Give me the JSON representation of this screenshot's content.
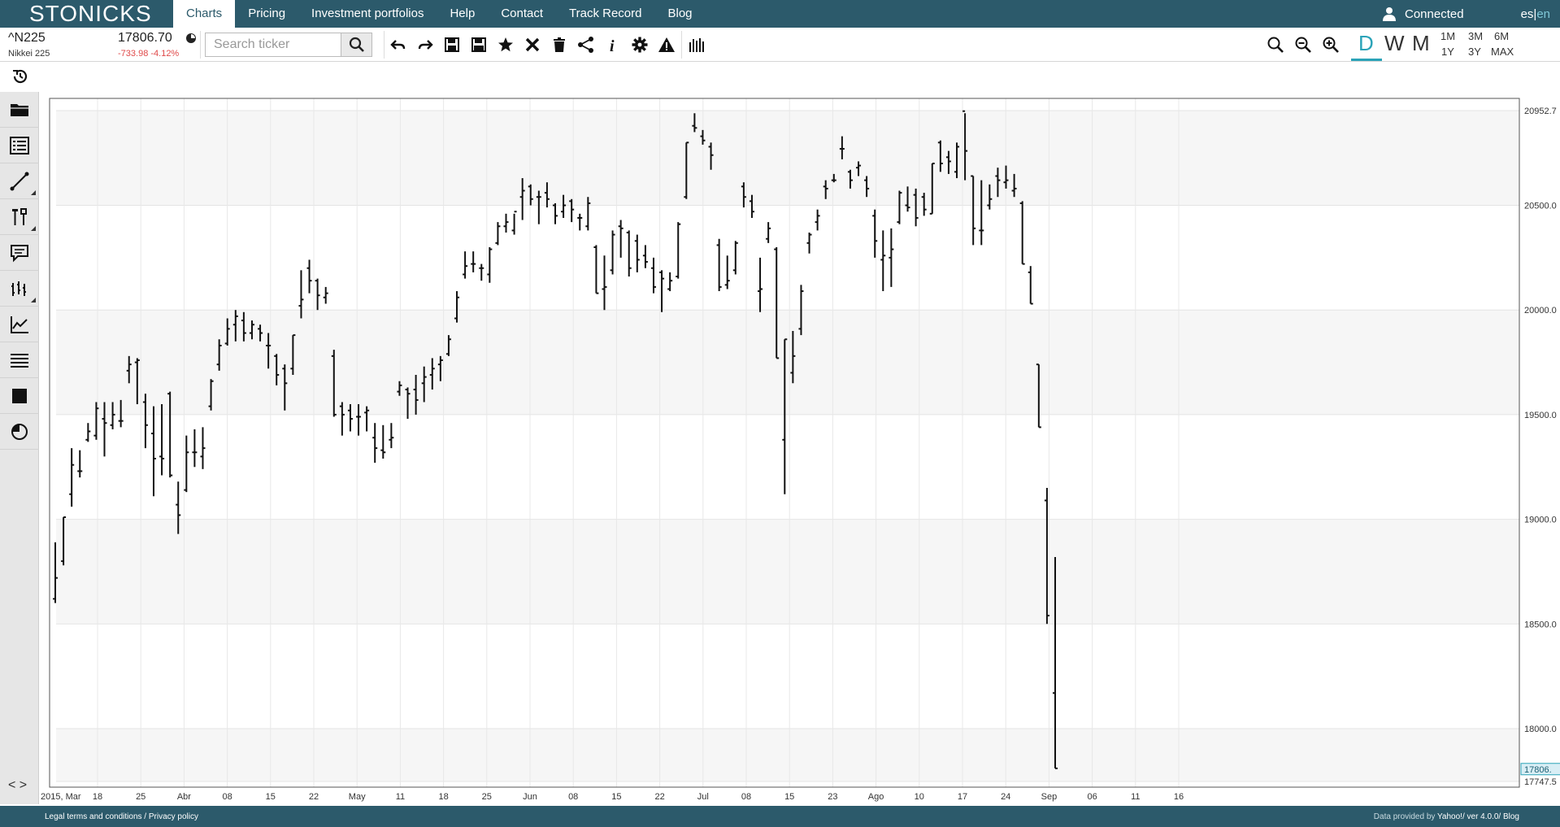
{
  "brand": {
    "logo_text": "STONICKS"
  },
  "nav": {
    "items": [
      {
        "label": "Charts",
        "active": true
      },
      {
        "label": "Pricing"
      },
      {
        "label": "Investment portfolios"
      },
      {
        "label": "Help"
      },
      {
        "label": "Contact"
      },
      {
        "label": "Track Record"
      },
      {
        "label": "Blog"
      }
    ],
    "user_status": "Connected",
    "lang_es": "es",
    "lang_sep": "|",
    "lang_en": "en"
  },
  "ticker": {
    "symbol": "^N225",
    "name": "Nikkei 225",
    "price": "17806.70",
    "change": "-733.98 -4.12%"
  },
  "search": {
    "placeholder": "Search ticker"
  },
  "toolbar_icons": [
    "undo-icon",
    "redo-icon",
    "save-icon",
    "save-all-icon",
    "star-icon",
    "close-icon",
    "trash-icon",
    "share-icon",
    "info-icon",
    "gear-icon",
    "warning-icon",
    "bar-chart-icon"
  ],
  "zoom_icons": [
    "search-icon",
    "zoom-out-icon",
    "zoom-in-icon"
  ],
  "periods": [
    {
      "label": "D",
      "active": true
    },
    {
      "label": "W"
    },
    {
      "label": "M"
    }
  ],
  "ranges": [
    "1M",
    "3M",
    "6M",
    "1Y",
    "3Y",
    "MAX"
  ],
  "sidebar": {
    "icons": [
      "folder-icon",
      "list-icon",
      "line-tool-icon",
      "tools-icon",
      "comment-icon",
      "indicators-icon",
      "line-chart-icon",
      "lines-icon",
      "square-icon",
      "pie-icon"
    ],
    "toggle_label": "< >"
  },
  "footer": {
    "legal": "Legal terms and conditions",
    "sep": " / ",
    "privacy": "Privacy policy",
    "provider_prefix": "Data provided by ",
    "provider": "Yahoo!",
    "version": "/ ver 4.0.0/ Blog"
  },
  "colors": {
    "nav_bg": "#2c5a6b",
    "accent": "#2ba3b8",
    "negative": "#e04a4a",
    "last_price_bg": "#d9eef5"
  },
  "chart_data": {
    "type": "ohlc",
    "ylim": [
      17747.5,
      20952.7
    ],
    "y_ticks": [
      "20952.7",
      "20500.0",
      "20000.0",
      "19500.0",
      "19000.0",
      "18500.0",
      "18000.0",
      "17747.5"
    ],
    "last_price_label": "17806.",
    "x_ticks": [
      "2015, Mar",
      "18",
      "25",
      "Abr",
      "08",
      "15",
      "22",
      "May",
      "11",
      "18",
      "25",
      "Jun",
      "08",
      "15",
      "22",
      "Jul",
      "08",
      "15",
      "23",
      "Ago",
      "10",
      "17",
      "24",
      "Sep",
      "06",
      "11",
      "16"
    ],
    "bars": [
      {
        "o": 18620,
        "h": 18890,
        "l": 18600,
        "c": 18720
      },
      {
        "o": 18800,
        "h": 19010,
        "l": 18780,
        "c": 19010
      },
      {
        "o": 19120,
        "h": 19340,
        "l": 19060,
        "c": 19260
      },
      {
        "o": 19230,
        "h": 19330,
        "l": 19200,
        "c": 19230
      },
      {
        "o": 19380,
        "h": 19460,
        "l": 19370,
        "c": 19420
      },
      {
        "o": 19400,
        "h": 19560,
        "l": 19380,
        "c": 19530
      },
      {
        "o": 19480,
        "h": 19560,
        "l": 19300,
        "c": 19460
      },
      {
        "o": 19450,
        "h": 19560,
        "l": 19430,
        "c": 19500
      },
      {
        "o": 19470,
        "h": 19570,
        "l": 19440,
        "c": 19470
      },
      {
        "o": 19710,
        "h": 19780,
        "l": 19650,
        "c": 19740
      },
      {
        "o": 19750,
        "h": 19770,
        "l": 19550,
        "c": 19760
      },
      {
        "o": 19560,
        "h": 19600,
        "l": 19340,
        "c": 19450
      },
      {
        "o": 19410,
        "h": 19540,
        "l": 19110,
        "c": 19290
      },
      {
        "o": 19300,
        "h": 19550,
        "l": 19210,
        "c": 19290
      },
      {
        "o": 19600,
        "h": 19610,
        "l": 19200,
        "c": 19210
      },
      {
        "o": 19070,
        "h": 19180,
        "l": 18930,
        "c": 19020
      },
      {
        "o": 19140,
        "h": 19400,
        "l": 19130,
        "c": 19320
      },
      {
        "o": 19320,
        "h": 19430,
        "l": 19250,
        "c": 19320
      },
      {
        "o": 19300,
        "h": 19440,
        "l": 19240,
        "c": 19340
      },
      {
        "o": 19540,
        "h": 19670,
        "l": 19520,
        "c": 19660
      },
      {
        "o": 19740,
        "h": 19860,
        "l": 19710,
        "c": 19830
      },
      {
        "o": 19840,
        "h": 19960,
        "l": 19830,
        "c": 19910
      },
      {
        "o": 19930,
        "h": 20000,
        "l": 19850,
        "c": 19970
      },
      {
        "o": 19950,
        "h": 19990,
        "l": 19850,
        "c": 19890
      },
      {
        "o": 19890,
        "h": 19950,
        "l": 19860,
        "c": 19930
      },
      {
        "o": 19910,
        "h": 19930,
        "l": 19850,
        "c": 19890
      },
      {
        "o": 19830,
        "h": 19890,
        "l": 19720,
        "c": 19830
      },
      {
        "o": 19780,
        "h": 19790,
        "l": 19640,
        "c": 19690
      },
      {
        "o": 19720,
        "h": 19740,
        "l": 19520,
        "c": 19650
      },
      {
        "o": 19720,
        "h": 19880,
        "l": 19690,
        "c": 19880
      },
      {
        "o": 20020,
        "h": 20190,
        "l": 19960,
        "c": 20050
      },
      {
        "o": 20200,
        "h": 20240,
        "l": 20080,
        "c": 20140
      },
      {
        "o": 20140,
        "h": 20150,
        "l": 20000,
        "c": 20070
      },
      {
        "o": 20060,
        "h": 20110,
        "l": 20030,
        "c": 20080
      },
      {
        "o": 19780,
        "h": 19810,
        "l": 19490,
        "c": 19500
      },
      {
        "o": 19540,
        "h": 19560,
        "l": 19400,
        "c": 19500
      },
      {
        "o": 19520,
        "h": 19550,
        "l": 19420,
        "c": 19480
      },
      {
        "o": 19490,
        "h": 19550,
        "l": 19400,
        "c": 19490
      },
      {
        "o": 19510,
        "h": 19540,
        "l": 19420,
        "c": 19520
      },
      {
        "o": 19390,
        "h": 19460,
        "l": 19270,
        "c": 19340
      },
      {
        "o": 19330,
        "h": 19450,
        "l": 19290,
        "c": 19320
      },
      {
        "o": 19380,
        "h": 19460,
        "l": 19340,
        "c": 19390
      },
      {
        "o": 19610,
        "h": 19660,
        "l": 19590,
        "c": 19640
      },
      {
        "o": 19620,
        "h": 19630,
        "l": 19480,
        "c": 19600
      },
      {
        "o": 19620,
        "h": 19690,
        "l": 19500,
        "c": 19570
      },
      {
        "o": 19650,
        "h": 19730,
        "l": 19560,
        "c": 19680
      },
      {
        "o": 19690,
        "h": 19770,
        "l": 19620,
        "c": 19720
      },
      {
        "o": 19740,
        "h": 19780,
        "l": 19660,
        "c": 19760
      },
      {
        "o": 19790,
        "h": 19880,
        "l": 19780,
        "c": 19860
      },
      {
        "o": 19960,
        "h": 20090,
        "l": 19940,
        "c": 20060
      },
      {
        "o": 20170,
        "h": 20280,
        "l": 20150,
        "c": 20210
      },
      {
        "o": 20220,
        "h": 20280,
        "l": 20180,
        "c": 20220
      },
      {
        "o": 20200,
        "h": 20220,
        "l": 20140,
        "c": 20200
      },
      {
        "o": 20170,
        "h": 20300,
        "l": 20130,
        "c": 20290
      },
      {
        "o": 20320,
        "h": 20420,
        "l": 20310,
        "c": 20400
      },
      {
        "o": 20400,
        "h": 20460,
        "l": 20370,
        "c": 20420
      },
      {
        "o": 20380,
        "h": 20460,
        "l": 20360,
        "c": 20470
      },
      {
        "o": 20540,
        "h": 20630,
        "l": 20430,
        "c": 20570
      },
      {
        "o": 20590,
        "h": 20600,
        "l": 20500,
        "c": 20530
      },
      {
        "o": 20540,
        "h": 20570,
        "l": 20410,
        "c": 20540
      },
      {
        "o": 20560,
        "h": 20610,
        "l": 20490,
        "c": 20530
      },
      {
        "o": 20500,
        "h": 20510,
        "l": 20410,
        "c": 20450
      },
      {
        "o": 20470,
        "h": 20550,
        "l": 20440,
        "c": 20500
      },
      {
        "o": 20520,
        "h": 20530,
        "l": 20420,
        "c": 20480
      },
      {
        "o": 20440,
        "h": 20460,
        "l": 20380,
        "c": 20440
      },
      {
        "o": 20400,
        "h": 20540,
        "l": 20380,
        "c": 20510
      },
      {
        "o": 20300,
        "h": 20310,
        "l": 20080,
        "c": 20080
      },
      {
        "o": 20100,
        "h": 20260,
        "l": 20000,
        "c": 20110
      },
      {
        "o": 20190,
        "h": 20380,
        "l": 20170,
        "c": 20360
      },
      {
        "o": 20400,
        "h": 20430,
        "l": 20250,
        "c": 20390
      },
      {
        "o": 20370,
        "h": 20380,
        "l": 20160,
        "c": 20200
      },
      {
        "o": 20330,
        "h": 20360,
        "l": 20180,
        "c": 20240
      },
      {
        "o": 20260,
        "h": 20310,
        "l": 20200,
        "c": 20230
      },
      {
        "o": 20200,
        "h": 20250,
        "l": 20080,
        "c": 20110
      },
      {
        "o": 20180,
        "h": 20190,
        "l": 19990,
        "c": 20150
      },
      {
        "o": 20100,
        "h": 20180,
        "l": 20090,
        "c": 20140
      },
      {
        "o": 20160,
        "h": 20420,
        "l": 20150,
        "c": 20410
      },
      {
        "o": 20540,
        "h": 20800,
        "l": 20530,
        "c": 20800
      },
      {
        "o": 20880,
        "h": 20940,
        "l": 20850,
        "c": 20870
      },
      {
        "o": 20830,
        "h": 20860,
        "l": 20790,
        "c": 20810
      },
      {
        "o": 20780,
        "h": 20800,
        "l": 20670,
        "c": 20740
      },
      {
        "o": 20310,
        "h": 20340,
        "l": 20090,
        "c": 20110
      },
      {
        "o": 20120,
        "h": 20260,
        "l": 20100,
        "c": 20140
      },
      {
        "o": 20190,
        "h": 20330,
        "l": 20170,
        "c": 20320
      },
      {
        "o": 20590,
        "h": 20610,
        "l": 20490,
        "c": 20540
      },
      {
        "o": 20520,
        "h": 20550,
        "l": 20440,
        "c": 20470
      },
      {
        "o": 20090,
        "h": 20250,
        "l": 19990,
        "c": 20100
      },
      {
        "o": 20340,
        "h": 20420,
        "l": 20320,
        "c": 20390
      },
      {
        "o": 20290,
        "h": 20300,
        "l": 19770,
        "c": 19770
      },
      {
        "o": 19380,
        "h": 19860,
        "l": 19120,
        "c": 19860
      },
      {
        "o": 19700,
        "h": 19900,
        "l": 19650,
        "c": 19780
      },
      {
        "o": 19910,
        "h": 20120,
        "l": 19880,
        "c": 20090
      },
      {
        "o": 20320,
        "h": 20370,
        "l": 20270,
        "c": 20360
      },
      {
        "o": 20420,
        "h": 20480,
        "l": 20380,
        "c": 20450
      },
      {
        "o": 20590,
        "h": 20620,
        "l": 20530,
        "c": 20580
      },
      {
        "o": 20620,
        "h": 20650,
        "l": 20610,
        "c": 20620
      },
      {
        "o": 20770,
        "h": 20830,
        "l": 20720,
        "c": 20770
      },
      {
        "o": 20660,
        "h": 20670,
        "l": 20580,
        "c": 20620
      },
      {
        "o": 20680,
        "h": 20710,
        "l": 20640,
        "c": 20690
      },
      {
        "o": 20620,
        "h": 20640,
        "l": 20540,
        "c": 20580
      },
      {
        "o": 20450,
        "h": 20480,
        "l": 20250,
        "c": 20330
      },
      {
        "o": 20240,
        "h": 20380,
        "l": 20090,
        "c": 20260
      },
      {
        "o": 20250,
        "h": 20390,
        "l": 20110,
        "c": 20290
      },
      {
        "o": 20420,
        "h": 20570,
        "l": 20410,
        "c": 20560
      },
      {
        "o": 20500,
        "h": 20590,
        "l": 20470,
        "c": 20490
      },
      {
        "o": 20550,
        "h": 20580,
        "l": 20400,
        "c": 20440
      },
      {
        "o": 20540,
        "h": 20560,
        "l": 20450,
        "c": 20480
      },
      {
        "o": 20460,
        "h": 20700,
        "l": 20460,
        "c": 20700
      },
      {
        "o": 20800,
        "h": 20810,
        "l": 20660,
        "c": 20700
      },
      {
        "o": 20730,
        "h": 20760,
        "l": 20650,
        "c": 20710
      },
      {
        "o": 20660,
        "h": 20800,
        "l": 20630,
        "c": 20780
      },
      {
        "o": 20950,
        "h": 20940,
        "l": 20620,
        "c": 20760
      },
      {
        "o": 20640,
        "h": 20640,
        "l": 20310,
        "c": 20390
      },
      {
        "o": 20380,
        "h": 20620,
        "l": 20310,
        "c": 20380
      },
      {
        "o": 20500,
        "h": 20600,
        "l": 20480,
        "c": 20530
      },
      {
        "o": 20640,
        "h": 20680,
        "l": 20540,
        "c": 20620
      },
      {
        "o": 20610,
        "h": 20690,
        "l": 20580,
        "c": 20620
      },
      {
        "o": 20570,
        "h": 20650,
        "l": 20540,
        "c": 20580
      },
      {
        "o": 20510,
        "h": 20520,
        "l": 20220,
        "c": 20220
      },
      {
        "o": 20180,
        "h": 20210,
        "l": 20030,
        "c": 20030
      },
      {
        "o": 19740,
        "h": 19740,
        "l": 19440,
        "c": 19440
      },
      {
        "o": 19090,
        "h": 19150,
        "l": 18500,
        "c": 18540
      },
      {
        "o": 18170,
        "h": 18820,
        "l": 17810,
        "c": 17810
      }
    ]
  }
}
